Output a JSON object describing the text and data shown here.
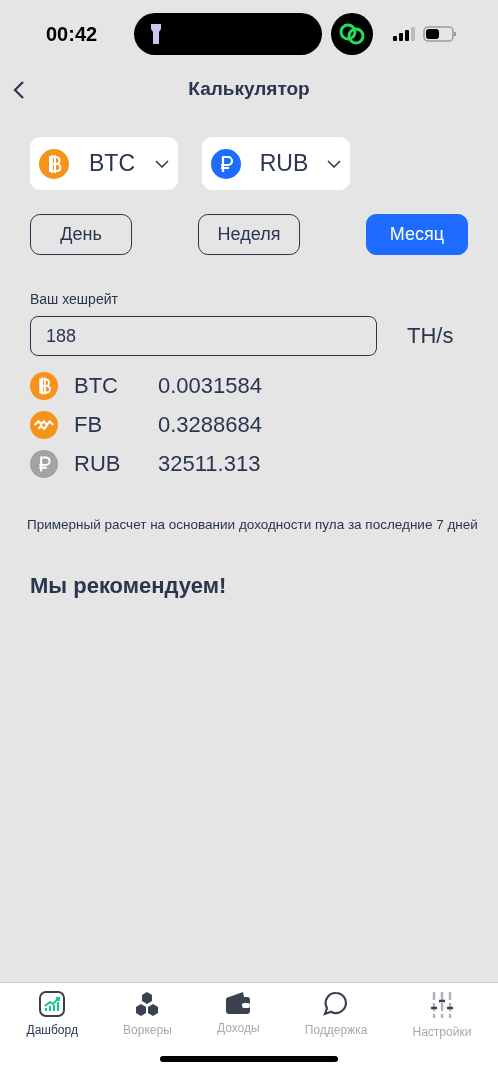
{
  "status_bar": {
    "time": "00:42"
  },
  "header": {
    "title": "Калькулятор"
  },
  "selectors": [
    {
      "kind": "btc",
      "label": "BTC"
    },
    {
      "kind": "rub",
      "label": "RUB"
    }
  ],
  "periods": [
    {
      "label": "День",
      "selected": false
    },
    {
      "label": "Неделя",
      "selected": false
    },
    {
      "label": "Месяц",
      "selected": true
    }
  ],
  "hashrate": {
    "label": "Ваш хешрейт",
    "value": "188",
    "unit": "TH/s"
  },
  "results": [
    {
      "kind": "btc",
      "name": "BTC",
      "amount": "0.0031584"
    },
    {
      "kind": "fb",
      "name": "FB",
      "amount": "0.3288684"
    },
    {
      "kind": "rub",
      "name": "RUB",
      "amount": "32511.313"
    }
  ],
  "note": "Примерный расчет на основании доходности пула за последние 7 дней",
  "recommend_title": "Мы рекомендуем!",
  "tab_bar": [
    {
      "kind": "dashboard",
      "label": "Дашборд",
      "selected": true
    },
    {
      "kind": "workers",
      "label": "Воркеры",
      "selected": false
    },
    {
      "kind": "income",
      "label": "Доходы",
      "selected": false
    },
    {
      "kind": "support",
      "label": "Поддержка",
      "selected": false
    },
    {
      "kind": "settings",
      "label": "Настройки",
      "selected": false
    }
  ]
}
